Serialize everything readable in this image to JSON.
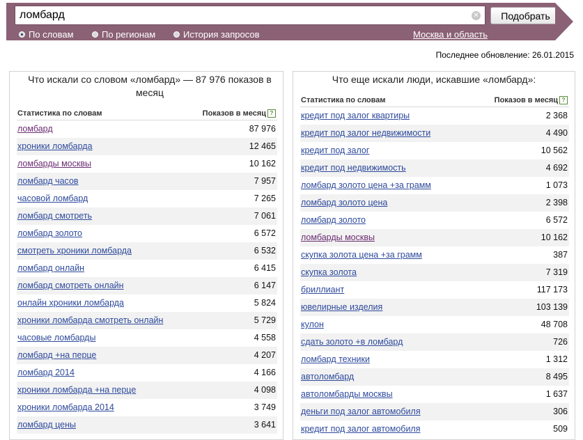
{
  "search": {
    "query": "ломбард",
    "submit_label": "Подобрать",
    "modes": [
      {
        "label": "По словам",
        "selected": true
      },
      {
        "label": "По регионам",
        "selected": false
      },
      {
        "label": "История запросов",
        "selected": false
      }
    ],
    "region": "Москва и область"
  },
  "last_update": "Последнее обновление: 26.01.2015",
  "left": {
    "title": "Что искали со словом «ломбард» — 87 976 показов в месяц",
    "col_keyword": "Статистика по словам",
    "col_count": "Показов в месяц",
    "rows": [
      {
        "keyword": "ломбард",
        "count": "87 976"
      },
      {
        "keyword": "хроники ломбарда",
        "count": "12 465"
      },
      {
        "keyword": "ломбарды москвы",
        "count": "10 162"
      },
      {
        "keyword": "ломбард часов",
        "count": "7 957"
      },
      {
        "keyword": "часовой ломбард",
        "count": "7 265"
      },
      {
        "keyword": "ломбард смотреть",
        "count": "7 061"
      },
      {
        "keyword": "ломбард золото",
        "count": "6 572"
      },
      {
        "keyword": "смотреть хроники ломбарда",
        "count": "6 532"
      },
      {
        "keyword": "ломбард онлайн",
        "count": "6 415"
      },
      {
        "keyword": "ломбард смотреть онлайн",
        "count": "6 147"
      },
      {
        "keyword": "онлайн хроники ломбарда",
        "count": "5 824"
      },
      {
        "keyword": "хроники ломбарда смотреть онлайн",
        "count": "5 729"
      },
      {
        "keyword": "часовые ломбарды",
        "count": "4 558"
      },
      {
        "keyword": "ломбард +на перце",
        "count": "4 207"
      },
      {
        "keyword": "ломбард 2014",
        "count": "4 166"
      },
      {
        "keyword": "хроники ломбарда +на перце",
        "count": "4 098"
      },
      {
        "keyword": "хроники ломбарда 2014",
        "count": "3 749"
      },
      {
        "keyword": "ломбард цены",
        "count": "3 641"
      }
    ]
  },
  "right": {
    "title": "Что еще искали люди, искавшие «ломбард»:",
    "col_keyword": "Статистика по словам",
    "col_count": "Показов в месяц",
    "rows": [
      {
        "keyword": "кредит под залог квартиры",
        "count": "2 368"
      },
      {
        "keyword": "кредит под залог недвижимости",
        "count": "4 490"
      },
      {
        "keyword": "кредит под залог",
        "count": "10 562"
      },
      {
        "keyword": "кредит под недвижимость",
        "count": "4 692"
      },
      {
        "keyword": "ломбард золото цена +за грамм",
        "count": "1 073"
      },
      {
        "keyword": "ломбард золото цена",
        "count": "2 398"
      },
      {
        "keyword": "ломбард золото",
        "count": "6 572"
      },
      {
        "keyword": "ломбарды москвы",
        "count": "10 162"
      },
      {
        "keyword": "скупка золота цена +за грамм",
        "count": "387"
      },
      {
        "keyword": "скупка золота",
        "count": "7 319"
      },
      {
        "keyword": "бриллиант",
        "count": "117 173"
      },
      {
        "keyword": "ювелирные изделия",
        "count": "103 139"
      },
      {
        "keyword": "кулон",
        "count": "48 708"
      },
      {
        "keyword": "сдать золото +в ломбард",
        "count": "726"
      },
      {
        "keyword": "ломбард техники",
        "count": "1 312"
      },
      {
        "keyword": "автоломбард",
        "count": "8 495"
      },
      {
        "keyword": "автоломбарды москвы",
        "count": "1 637"
      },
      {
        "keyword": "деньги под залог автомобиля",
        "count": "306"
      },
      {
        "keyword": "кредит под залог автомобиля",
        "count": "509"
      }
    ]
  }
}
